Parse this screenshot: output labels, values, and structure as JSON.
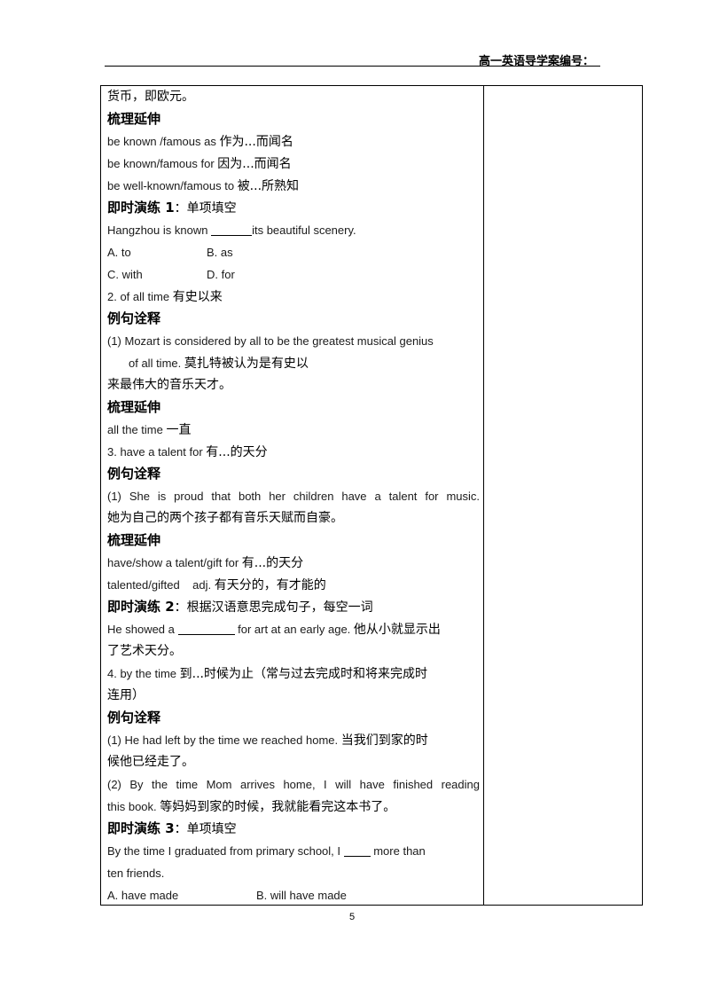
{
  "header": {
    "title": "高一英语导学案编号："
  },
  "lines": {
    "l1": "货币，即欧元。",
    "l2": "梳理延伸",
    "l3_en": "be known  /famous as ",
    "l3_cn": "作为...而闻名",
    "l4_en": "be known/famous for ",
    "l4_cn": "因为...而闻名",
    "l5_en": "be well-known/famous to ",
    "l5_cn": "被...所熟知",
    "l6_bold": "即时演练 1",
    "l6_cn": "：单项填空",
    "l7_pre": "Hangzhou is known ",
    "l7_post": "its beautiful scenery.",
    "l8_a": "A. to",
    "l8_b": "B. as",
    "l9_c": "C. with",
    "l9_d": "D. for",
    "l10_en": "2. of all time ",
    "l10_cn": "有史以来",
    "l11": "例句诠释",
    "l12": "(1)  Mozart is considered by all to be the greatest musical genius",
    "l13_en": "of all time. ",
    "l13_cn": "莫扎特被认为是有史以",
    "l14": "来最伟大的音乐天才。",
    "l15": "梳理延伸",
    "l16_en": "all the time ",
    "l16_cn": "一直",
    "l17_en": "3. have a talent for ",
    "l17_cn": "有...的天分",
    "l18": "例句诠释",
    "l19": "(1) She is proud that both her children have a talent for music.",
    "l20": "她为自己的两个孩子都有音乐天赋而自豪。",
    "l21": "梳理延伸",
    "l22_en": "have/show a talent/gift for ",
    "l22_cn": "有...的天分",
    "l23_en": "talented/gifted    adj. ",
    "l23_cn": "有天分的，有才能的",
    "l24_bold": "即时演练 2",
    "l24_cn": "：根据汉语意思完成句子，每空一词",
    "l25_pre": "He showed a ",
    "l25_post": " for art at an early age. ",
    "l25_cn": "他从小就显示出",
    "l26": "了艺术天分。",
    "l27_en": "4. by the time ",
    "l27_cn": "到...时候为止（常与过去完成时和将来完成时",
    "l28": "连用）",
    "l29": "例句诠释",
    "l30_en": "(1) He had left by the time we reached home. ",
    "l30_cn": "当我们到家的时",
    "l31": "候他已经走了。",
    "l32": "(2) By the time Mom arrives home, I will have finished reading",
    "l33_en": "this book. ",
    "l33_cn": "等妈妈到家的时候，我就能看完这本书了。",
    "l34_bold": "即时演练 3",
    "l34_cn": "：单项填空",
    "l35_pre": "By the time I graduated from primary school, I ",
    "l35_post": " more than",
    "l36": "ten friends.",
    "l37_a": "A. have made",
    "l37_b": "B. will have made"
  },
  "footer": {
    "page_number": "5"
  }
}
